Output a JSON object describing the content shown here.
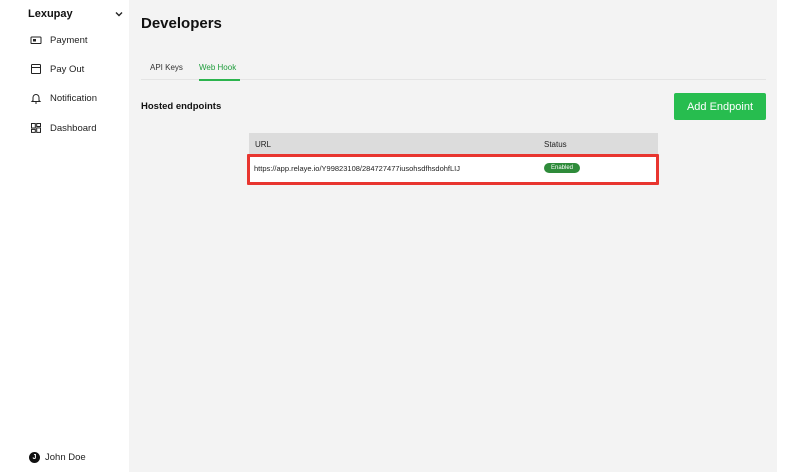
{
  "sidebar": {
    "brand": "Lexupay",
    "items": [
      {
        "label": "Payment",
        "icon": "payment-icon"
      },
      {
        "label": "Pay Out",
        "icon": "payout-icon"
      },
      {
        "label": "Notification",
        "icon": "bell-icon"
      },
      {
        "label": "Dashboard",
        "icon": "dashboard-icon"
      }
    ],
    "user": {
      "initial": "J",
      "name": "John Doe"
    }
  },
  "main": {
    "title": "Developers",
    "tabs": [
      {
        "label": "API Keys",
        "active": false
      },
      {
        "label": "Web Hook",
        "active": true
      }
    ],
    "section_title": "Hosted endpoints",
    "add_button": "Add Endpoint",
    "table": {
      "columns": [
        "URL",
        "Status"
      ],
      "rows": [
        {
          "url": "https://app.relaye.io/Y99823108/284727477iusohsdfhsdohfLIJ",
          "status": "Enabled"
        }
      ]
    }
  },
  "colors": {
    "accent_green": "#27bd4f",
    "badge_green": "#2e8b3a",
    "highlight_red": "#e8352f",
    "content_bg": "#f3f3f3"
  }
}
